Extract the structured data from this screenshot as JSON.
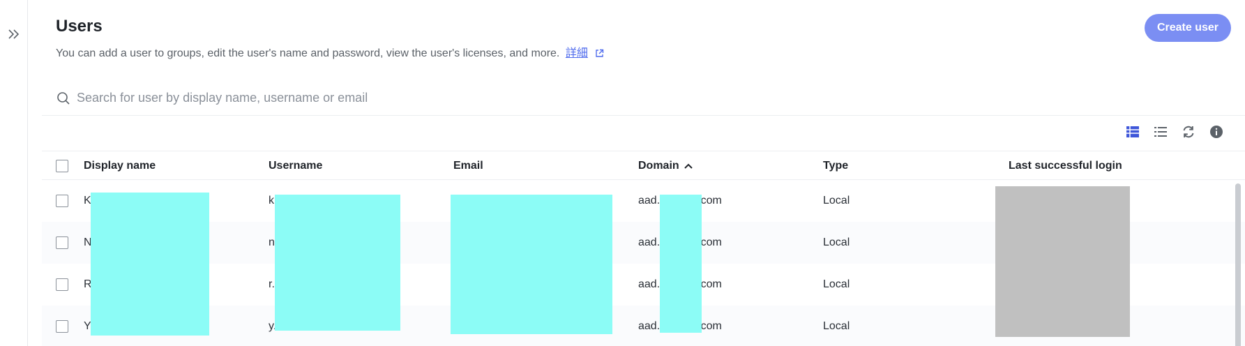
{
  "page": {
    "title": "Users",
    "subtitle": "You can add a user to groups, edit the user's name and password, view the user's licenses, and more.",
    "details_link": "詳細",
    "create_button": "Create user"
  },
  "search": {
    "placeholder": "Search for user by display name, username or email"
  },
  "columns": {
    "display_name": "Display name",
    "username": "Username",
    "email": "Email",
    "domain": "Domain",
    "type": "Type",
    "last_login": "Last successful login"
  },
  "sort": {
    "column": "Domain",
    "direction": "ascending"
  },
  "rows": [
    {
      "name": "K",
      "username": "k",
      "email": "",
      "domain_prefix": "aad.",
      "domain_suffix": ".com",
      "type": "Local"
    },
    {
      "name": "N",
      "username": "n",
      "email": "",
      "domain_prefix": "aad.",
      "domain_suffix": ".com",
      "type": "Local"
    },
    {
      "name": "R",
      "username": "r.",
      "email": "",
      "domain_prefix": "aad.",
      "domain_suffix": ".com",
      "type": "Local"
    },
    {
      "name": "Y",
      "username": "y.",
      "email": "",
      "domain_prefix": "aad.",
      "domain_suffix": ".com",
      "type": "Local"
    }
  ],
  "icons": {
    "expand": "double-chevron-right-icon",
    "search": "search-icon",
    "external": "external-link-icon",
    "table_view": "table-view-icon",
    "list_view": "list-view-icon",
    "refresh": "refresh-icon",
    "info": "info-icon",
    "sort": "chevron-up-icon"
  },
  "colors": {
    "accent": "#4f6bed",
    "button": "#7b8ef3",
    "redaction": "#8cfcf6",
    "redaction_gray": "#c0c0c0"
  }
}
